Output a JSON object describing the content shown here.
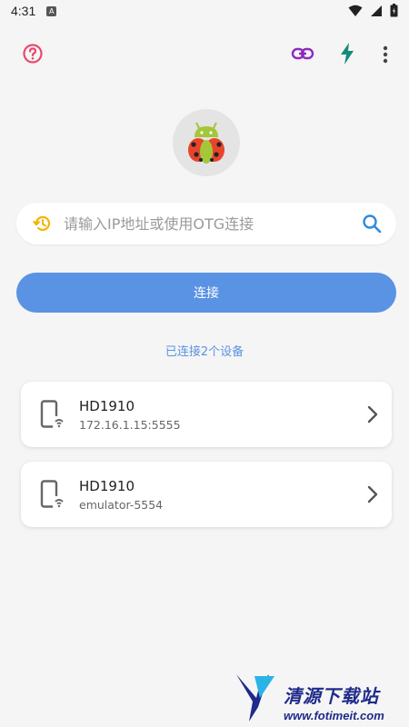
{
  "status_bar": {
    "time": "4:31",
    "notification_badge": "A"
  },
  "toolbar": {
    "help_icon": "help-circle-icon",
    "link_icon": "link-icon",
    "flash_icon": "flash-icon",
    "more_icon": "more-vertical-icon"
  },
  "colors": {
    "accent": "#5b93e4",
    "help": "#e84a6f",
    "link": "#8e2bbf",
    "flash": "#178a7a",
    "history": "#f4b400",
    "search": "#2f8be0"
  },
  "search": {
    "placeholder": "请输入IP地址或使用OTG连接",
    "value": ""
  },
  "connect_button": {
    "label": "连接"
  },
  "connected_count": "已连接2个设备",
  "devices": [
    {
      "name": "HD1910",
      "address": "172.16.1.15:5555"
    },
    {
      "name": "HD1910",
      "address": "emulator-5554"
    }
  ],
  "watermark": {
    "title": "清源下载站",
    "url": "www.fotimeit.com"
  }
}
